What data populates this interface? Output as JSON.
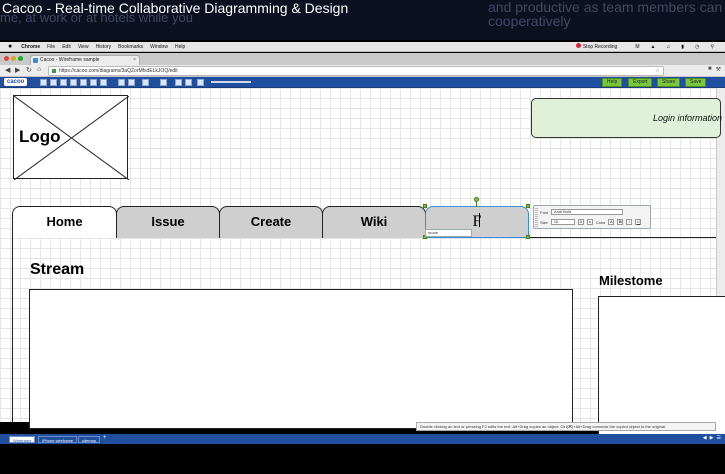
{
  "video": {
    "title": "Cacoo - Real-time Collaborative Diagramming & Design",
    "bg_left": "me, at work or at hotels while you",
    "bg_right_1": "and productive as team members can",
    "bg_right_2": "cooperatively"
  },
  "menubar": {
    "items": [
      "Chrome",
      "File",
      "Edit",
      "View",
      "History",
      "Bookmarks",
      "Window",
      "Help"
    ],
    "recording": "Stop Recording"
  },
  "browser": {
    "tab_title": "Cacoo - Wireframe sample",
    "tab_close": "×",
    "url": "https://cacoo.com/diagrams/3aQZorMfxdELkJOQ/edit"
  },
  "editor": {
    "brand": "cacoo",
    "buttons": [
      "Help",
      "Export",
      "Share",
      "Save"
    ]
  },
  "wireframe": {
    "logo_label": "Logo",
    "login_label": "Login information",
    "tabs": [
      "Home",
      "Issue",
      "Create",
      "Wiki",
      "F"
    ],
    "caption_text": "mode",
    "stream_title": "Stream",
    "milestone_title": "Milestome"
  },
  "font_panel": {
    "font_label": "Font",
    "font_value": "Arial Bold",
    "size_label": "Size",
    "size_value": "16",
    "color_label": "Color",
    "bold": "B",
    "italic": "I",
    "underline": "U"
  },
  "tooltip": "Double clicking an text or pressing F2 edits the text. Alt+Drag copies an object. Ctrl(⌘)+Alt+Drag connects the copied object to the original.",
  "sheets": {
    "tabs": [
      "Wireframe",
      "iPhone wireframe",
      "sitemap"
    ],
    "add": "+"
  }
}
